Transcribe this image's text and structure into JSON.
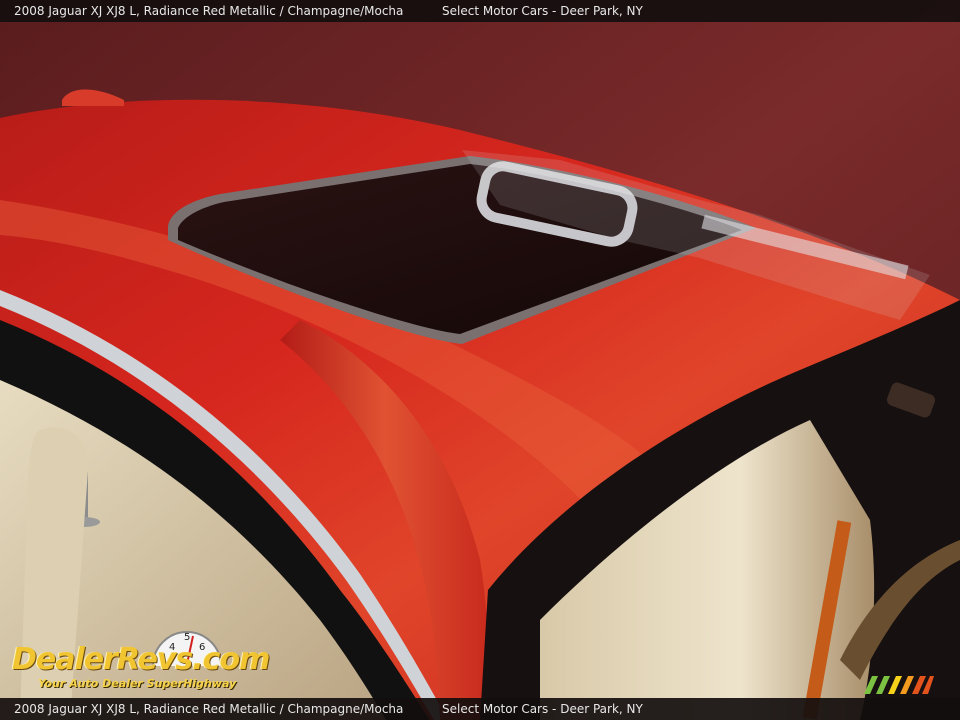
{
  "header": {
    "vehicle_text": "2008 Jaguar XJ XJ8 L,  Radiance Red Metallic / Champagne/Mocha",
    "dealer_text": "Select Motor Cars - Deer Park, NY"
  },
  "footer": {
    "vehicle_text": "2008 Jaguar XJ XJ8 L,  Radiance Red Metallic / Champagne/Mocha",
    "dealer_text": "Select Motor Cars - Deer Park, NY"
  },
  "watermark": {
    "brand": "DealerRevs.com",
    "tagline": "Your Auto Dealer SuperHighway",
    "gauge_numbers": [
      "4",
      "5",
      "6"
    ]
  },
  "colors": {
    "car_paint": "#c8221d",
    "backdrop": "#6e2526",
    "interior": "#cdbb9a",
    "logo_gold": "#f1c531",
    "accent_stripes": [
      "#7cc242",
      "#f7d21a",
      "#f39a1f",
      "#e5531d"
    ]
  }
}
